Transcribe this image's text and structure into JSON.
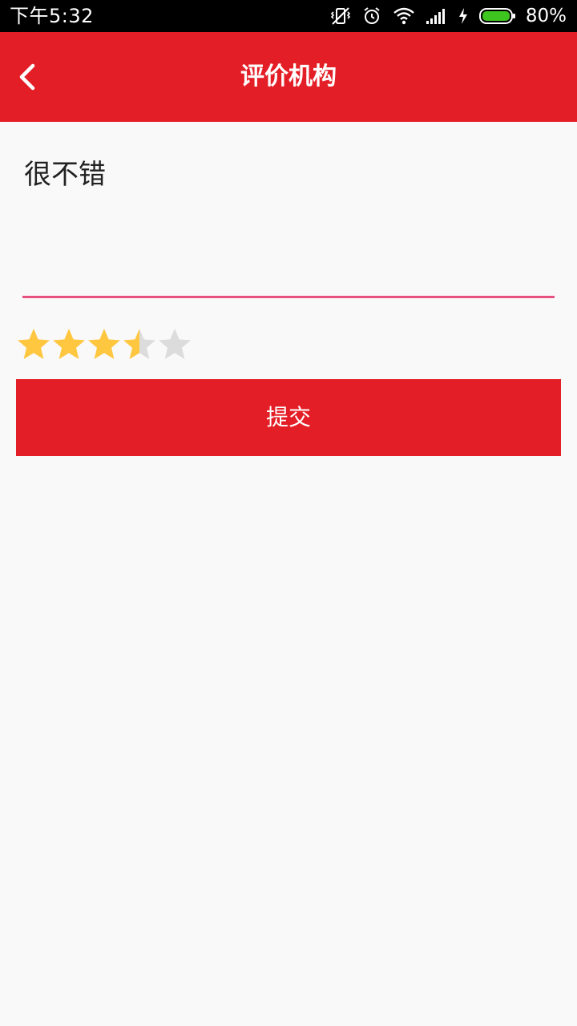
{
  "status_bar": {
    "time": "下午5:32",
    "battery_percent": "80%",
    "battery_level": 0.8,
    "icons": [
      "vibrate-off-icon",
      "alarm-icon",
      "wifi-icon",
      "signal-icon",
      "charging-icon",
      "battery-icon"
    ]
  },
  "header": {
    "title": "评价机构",
    "back_icon": "chevron-left-icon"
  },
  "review": {
    "comment": "很不错",
    "rating": 3.5,
    "max_rating": 5
  },
  "submit": {
    "label": "提交"
  },
  "colors": {
    "primary": "#e41e26",
    "input_underline": "#e8507f",
    "star_filled": "#ffc63f",
    "star_empty": "#dcdcdc",
    "background": "#f9f9f9",
    "battery_fill": "#3fc51f"
  }
}
